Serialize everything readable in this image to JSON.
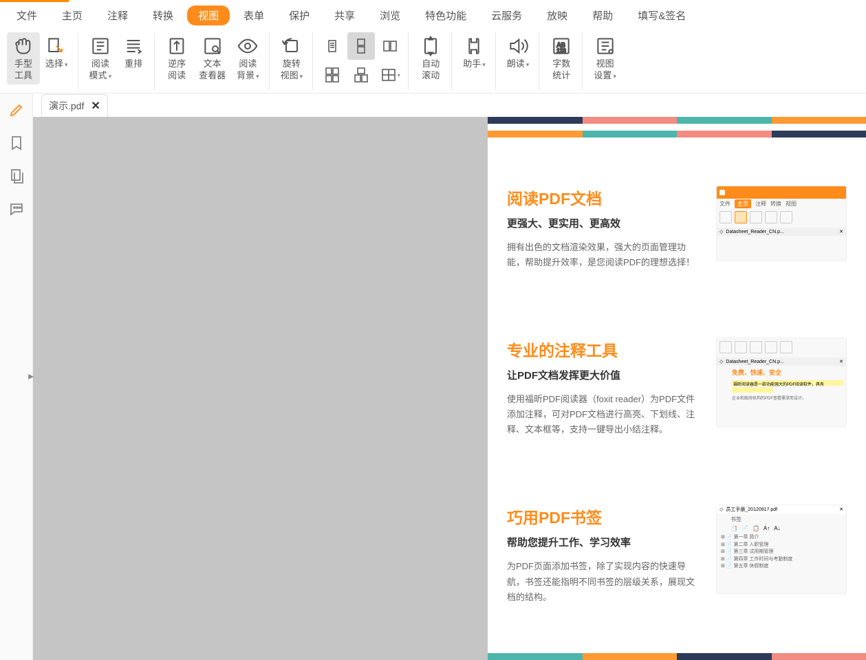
{
  "menu": {
    "items": [
      "文件",
      "主页",
      "注释",
      "转换",
      "视图",
      "表单",
      "保护",
      "共享",
      "浏览",
      "特色功能",
      "云服务",
      "放映",
      "帮助",
      "填写&签名"
    ],
    "active_index": 4
  },
  "ribbon": {
    "hand_tool": "手型\n工具",
    "select": "选择",
    "read_mode": "阅读\n模式",
    "reflow": "重排",
    "reverse_read": "逆序\n阅读",
    "text_viewer": "文本\n查看器",
    "read_bg": "阅读\n背景",
    "rotate_view": "旋转\n视图",
    "auto_scroll": "自动\n滚动",
    "assistant": "助手",
    "read_aloud": "朗读",
    "word_count": "字数\n统计",
    "view_settings": "视图\n设置"
  },
  "document": {
    "tab_name": "演示.pdf"
  },
  "features": [
    {
      "title": "阅读PDF文档",
      "subtitle": "更强大、更实用、更高效",
      "desc": "拥有出色的文档渲染效果，强大的页面管理功能，帮助提升效率，是您阅读PDF的理想选择！",
      "mini_tabs": [
        "文件",
        "主页",
        "注释",
        "转换",
        "视图"
      ],
      "mini_doc": "Datasheet_Reader_CN.p..."
    },
    {
      "title": "专业的注释工具",
      "subtitle": "让PDF文档发挥更大价值",
      "desc": "使用福昕PDF阅读器（foxit reader）为PDF文件添加注释，可对PDF文档进行高亮、下划线、注释、文本框等，支持一键导出小结注释。",
      "mini_doc": "Datasheet_Reader_CN.p...",
      "mini_headline": "免费、快速、安全",
      "mini_text1": "福昕阅读器是一款功能强大的PDF阅读软件，具有",
      "mini_text2": "企业和政府机构的PDF查看需求而设计。"
    },
    {
      "title": "巧用PDF书签",
      "subtitle": "帮助您提升工作、学习效率",
      "desc": "为PDF页面添加书签，除了实现内容的快速导航，书签还能指明不同书签的层级关系，展现文档的结构。",
      "mini_doc": "员工手册_20120917.pdf",
      "mini_bookmark_label": "书签",
      "mini_tree": [
        "第一章  简介",
        "第二章  入职管理",
        "第三章  试用期管理",
        "第四章  工作时间与考勤制度",
        "第五章  休假制度"
      ]
    }
  ],
  "colors": {
    "accent": "#ff8c1a",
    "navy": "#2e3a59",
    "pink": "#f28b82",
    "teal": "#4db6ac"
  }
}
